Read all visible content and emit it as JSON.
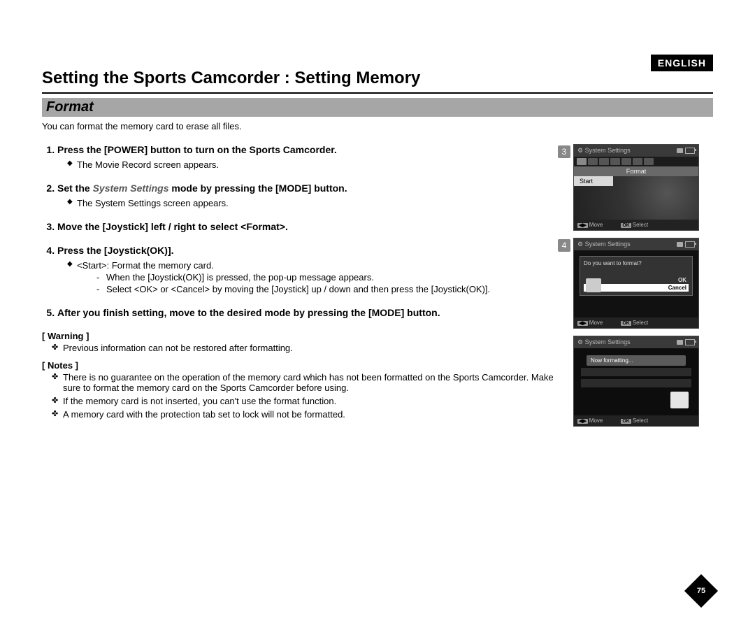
{
  "lang_badge": "ENGLISH",
  "page_title": "Setting the Sports Camcorder : Setting Memory",
  "section_title": "Format",
  "intro": "You can format the memory card to erase all files.",
  "system_settings_phrase": "System Settings",
  "steps": [
    {
      "text_before": "Press the [POWER] button to turn on the Sports Camcorder.",
      "subs": [
        "The Movie Record screen appears."
      ]
    },
    {
      "text_before": "Set the ",
      "emph": "System Settings",
      "text_after": " mode by pressing the [MODE] button.",
      "subs": [
        "The System Settings screen appears."
      ]
    },
    {
      "text_before": "Move the [Joystick] left / right to select <Format>.",
      "subs": []
    },
    {
      "text_before": "Press the [Joystick(OK)].",
      "subs": [
        "<Start>: Format the memory card."
      ],
      "dashes": [
        "When the [Joystick(OK)] is pressed, the pop-up message appears.",
        "Select <OK> or <Cancel> by moving the [Joystick] up / down and then press the [Joystick(OK)]."
      ]
    },
    {
      "text_before": "After you finish setting, move to the desired mode by pressing the [MODE] button.",
      "subs": []
    }
  ],
  "warning_label": "[ Warning ]",
  "warnings": [
    "Previous information can not be restored after formatting."
  ],
  "notes_label": "[ Notes ]",
  "notes": [
    "There is no guarantee on the operation of the memory card which has not been formatted on the Sports Camcorder. Make sure to format the memory card on the Sports Camcorder before using.",
    "If the memory card is not inserted, you can't use the format function.",
    "A memory card with the protection tab set to lock will not be formatted."
  ],
  "page_number": "75",
  "screens": {
    "s3": {
      "num": "3",
      "title": "System Settings",
      "menu": "Format",
      "option": "Start",
      "move": "Move",
      "select": "Select"
    },
    "s4": {
      "num": "4",
      "title": "System Settings",
      "prompt": "Do you want to format?",
      "ok": "OK",
      "cancel": "Cancel",
      "move": "Move",
      "select": "Select"
    },
    "s5": {
      "title": "System Settings",
      "status": "Now formatting...",
      "move": "Move",
      "select": "Select"
    }
  }
}
